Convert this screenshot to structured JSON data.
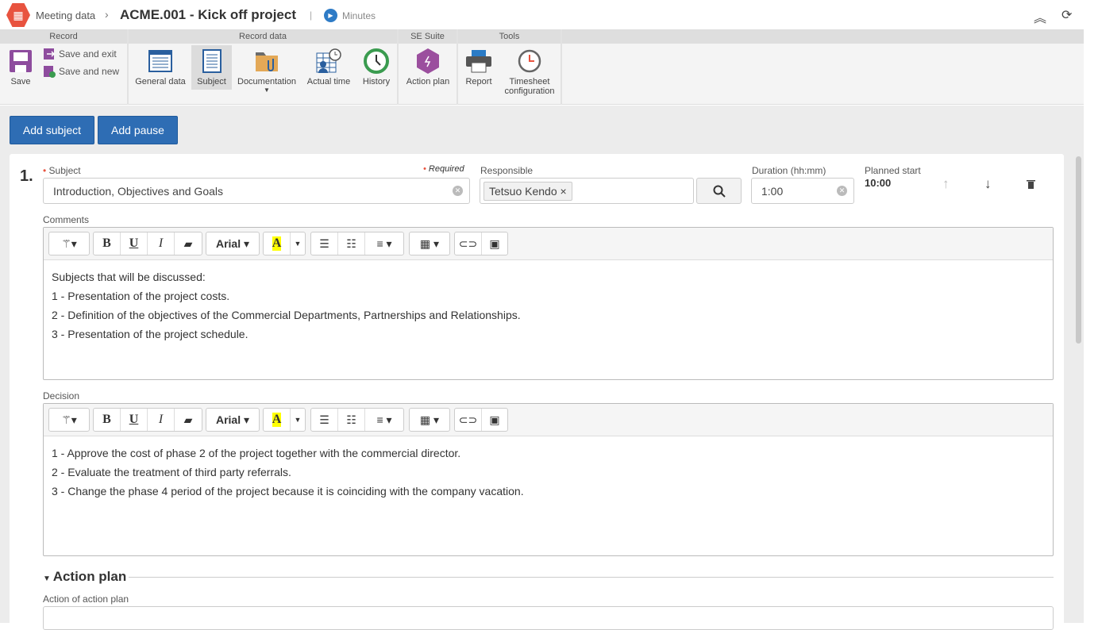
{
  "header": {
    "breadcrumb": "Meeting data",
    "title": "ACME.001 - Kick off project",
    "status": "Minutes"
  },
  "ribbon": {
    "groups": [
      "Record",
      "Record data",
      "SE Suite",
      "Tools"
    ],
    "save": "Save",
    "save_exit": "Save and exit",
    "save_new": "Save and new",
    "general_data": "General data",
    "subject": "Subject",
    "documentation": "Documentation",
    "actual_time": "Actual time",
    "history": "History",
    "action_plan": "Action plan",
    "report": "Report",
    "timesheet": "Timesheet configuration"
  },
  "actions": {
    "add_subject": "Add subject",
    "add_pause": "Add pause"
  },
  "subject_item": {
    "number": "1.",
    "subject_label": "Subject",
    "required": "Required",
    "subject_value": "Introduction, Objectives and Goals",
    "responsible_label": "Responsible",
    "responsible_tag": "Tetsuo Kendo",
    "duration_label": "Duration (hh:mm)",
    "duration_value": "1:00",
    "planned_start_label": "Planned start",
    "planned_start_value": "10:00",
    "comments_label": "Comments",
    "comments_lines": [
      "Subjects that will be discussed:",
      "1 - Presentation of the project costs.",
      "2 - Definition of the objectives of the Commercial Departments, Partnerships and Relationships.",
      "3 - Presentation of the project schedule."
    ],
    "decision_label": "Decision",
    "decision_lines": [
      "1 - Approve the cost of phase 2 of the project together with the commercial director.",
      "2 - Evaluate the treatment of third party referrals.",
      "3 - Change the phase 4 period of the project because it is coinciding with the company vacation."
    ],
    "font_name": "Arial",
    "action_plan_title": "Action plan",
    "action_of_plan_label": "Action of action plan"
  }
}
